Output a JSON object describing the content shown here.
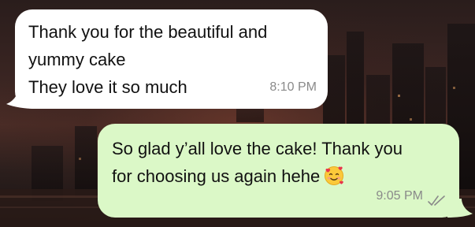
{
  "messages": [
    {
      "direction": "incoming",
      "lines": [
        "Thank you for the beautiful and",
        "yummy cake",
        "They love it so much"
      ],
      "time": "8:10 PM"
    },
    {
      "direction": "outgoing",
      "lines": [
        "So glad y’all love the cake! Thank you",
        "for choosing us again hehe"
      ],
      "emoji": "smiling-face-with-hearts",
      "time": "9:05 PM",
      "status": "read-double-tick"
    }
  ],
  "colors": {
    "incoming_bubble": "#ffffff",
    "outgoing_bubble": "#dbf8c7",
    "timestamp": "#8a8a8a",
    "wallpaper": "#2a1d1c"
  }
}
